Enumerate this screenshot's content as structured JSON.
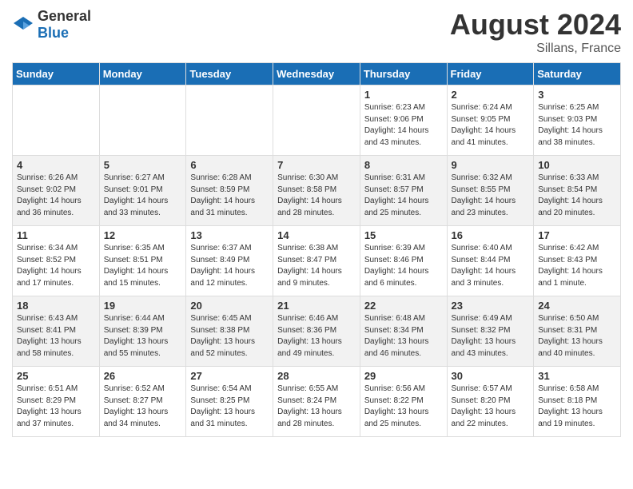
{
  "header": {
    "logo_general": "General",
    "logo_blue": "Blue",
    "title": "August 2024",
    "location": "Sillans, France"
  },
  "weekdays": [
    "Sunday",
    "Monday",
    "Tuesday",
    "Wednesday",
    "Thursday",
    "Friday",
    "Saturday"
  ],
  "weeks": [
    [
      {
        "day": "",
        "sunrise": "",
        "sunset": "",
        "daylight": ""
      },
      {
        "day": "",
        "sunrise": "",
        "sunset": "",
        "daylight": ""
      },
      {
        "day": "",
        "sunrise": "",
        "sunset": "",
        "daylight": ""
      },
      {
        "day": "",
        "sunrise": "",
        "sunset": "",
        "daylight": ""
      },
      {
        "day": "1",
        "sunrise": "Sunrise: 6:23 AM",
        "sunset": "Sunset: 9:06 PM",
        "daylight": "Daylight: 14 hours and 43 minutes."
      },
      {
        "day": "2",
        "sunrise": "Sunrise: 6:24 AM",
        "sunset": "Sunset: 9:05 PM",
        "daylight": "Daylight: 14 hours and 41 minutes."
      },
      {
        "day": "3",
        "sunrise": "Sunrise: 6:25 AM",
        "sunset": "Sunset: 9:03 PM",
        "daylight": "Daylight: 14 hours and 38 minutes."
      }
    ],
    [
      {
        "day": "4",
        "sunrise": "Sunrise: 6:26 AM",
        "sunset": "Sunset: 9:02 PM",
        "daylight": "Daylight: 14 hours and 36 minutes."
      },
      {
        "day": "5",
        "sunrise": "Sunrise: 6:27 AM",
        "sunset": "Sunset: 9:01 PM",
        "daylight": "Daylight: 14 hours and 33 minutes."
      },
      {
        "day": "6",
        "sunrise": "Sunrise: 6:28 AM",
        "sunset": "Sunset: 8:59 PM",
        "daylight": "Daylight: 14 hours and 31 minutes."
      },
      {
        "day": "7",
        "sunrise": "Sunrise: 6:30 AM",
        "sunset": "Sunset: 8:58 PM",
        "daylight": "Daylight: 14 hours and 28 minutes."
      },
      {
        "day": "8",
        "sunrise": "Sunrise: 6:31 AM",
        "sunset": "Sunset: 8:57 PM",
        "daylight": "Daylight: 14 hours and 25 minutes."
      },
      {
        "day": "9",
        "sunrise": "Sunrise: 6:32 AM",
        "sunset": "Sunset: 8:55 PM",
        "daylight": "Daylight: 14 hours and 23 minutes."
      },
      {
        "day": "10",
        "sunrise": "Sunrise: 6:33 AM",
        "sunset": "Sunset: 8:54 PM",
        "daylight": "Daylight: 14 hours and 20 minutes."
      }
    ],
    [
      {
        "day": "11",
        "sunrise": "Sunrise: 6:34 AM",
        "sunset": "Sunset: 8:52 PM",
        "daylight": "Daylight: 14 hours and 17 minutes."
      },
      {
        "day": "12",
        "sunrise": "Sunrise: 6:35 AM",
        "sunset": "Sunset: 8:51 PM",
        "daylight": "Daylight: 14 hours and 15 minutes."
      },
      {
        "day": "13",
        "sunrise": "Sunrise: 6:37 AM",
        "sunset": "Sunset: 8:49 PM",
        "daylight": "Daylight: 14 hours and 12 minutes."
      },
      {
        "day": "14",
        "sunrise": "Sunrise: 6:38 AM",
        "sunset": "Sunset: 8:47 PM",
        "daylight": "Daylight: 14 hours and 9 minutes."
      },
      {
        "day": "15",
        "sunrise": "Sunrise: 6:39 AM",
        "sunset": "Sunset: 8:46 PM",
        "daylight": "Daylight: 14 hours and 6 minutes."
      },
      {
        "day": "16",
        "sunrise": "Sunrise: 6:40 AM",
        "sunset": "Sunset: 8:44 PM",
        "daylight": "Daylight: 14 hours and 3 minutes."
      },
      {
        "day": "17",
        "sunrise": "Sunrise: 6:42 AM",
        "sunset": "Sunset: 8:43 PM",
        "daylight": "Daylight: 14 hours and 1 minute."
      }
    ],
    [
      {
        "day": "18",
        "sunrise": "Sunrise: 6:43 AM",
        "sunset": "Sunset: 8:41 PM",
        "daylight": "Daylight: 13 hours and 58 minutes."
      },
      {
        "day": "19",
        "sunrise": "Sunrise: 6:44 AM",
        "sunset": "Sunset: 8:39 PM",
        "daylight": "Daylight: 13 hours and 55 minutes."
      },
      {
        "day": "20",
        "sunrise": "Sunrise: 6:45 AM",
        "sunset": "Sunset: 8:38 PM",
        "daylight": "Daylight: 13 hours and 52 minutes."
      },
      {
        "day": "21",
        "sunrise": "Sunrise: 6:46 AM",
        "sunset": "Sunset: 8:36 PM",
        "daylight": "Daylight: 13 hours and 49 minutes."
      },
      {
        "day": "22",
        "sunrise": "Sunrise: 6:48 AM",
        "sunset": "Sunset: 8:34 PM",
        "daylight": "Daylight: 13 hours and 46 minutes."
      },
      {
        "day": "23",
        "sunrise": "Sunrise: 6:49 AM",
        "sunset": "Sunset: 8:32 PM",
        "daylight": "Daylight: 13 hours and 43 minutes."
      },
      {
        "day": "24",
        "sunrise": "Sunrise: 6:50 AM",
        "sunset": "Sunset: 8:31 PM",
        "daylight": "Daylight: 13 hours and 40 minutes."
      }
    ],
    [
      {
        "day": "25",
        "sunrise": "Sunrise: 6:51 AM",
        "sunset": "Sunset: 8:29 PM",
        "daylight": "Daylight: 13 hours and 37 minutes."
      },
      {
        "day": "26",
        "sunrise": "Sunrise: 6:52 AM",
        "sunset": "Sunset: 8:27 PM",
        "daylight": "Daylight: 13 hours and 34 minutes."
      },
      {
        "day": "27",
        "sunrise": "Sunrise: 6:54 AM",
        "sunset": "Sunset: 8:25 PM",
        "daylight": "Daylight: 13 hours and 31 minutes."
      },
      {
        "day": "28",
        "sunrise": "Sunrise: 6:55 AM",
        "sunset": "Sunset: 8:24 PM",
        "daylight": "Daylight: 13 hours and 28 minutes."
      },
      {
        "day": "29",
        "sunrise": "Sunrise: 6:56 AM",
        "sunset": "Sunset: 8:22 PM",
        "daylight": "Daylight: 13 hours and 25 minutes."
      },
      {
        "day": "30",
        "sunrise": "Sunrise: 6:57 AM",
        "sunset": "Sunset: 8:20 PM",
        "daylight": "Daylight: 13 hours and 22 minutes."
      },
      {
        "day": "31",
        "sunrise": "Sunrise: 6:58 AM",
        "sunset": "Sunset: 8:18 PM",
        "daylight": "Daylight: 13 hours and 19 minutes."
      }
    ]
  ]
}
